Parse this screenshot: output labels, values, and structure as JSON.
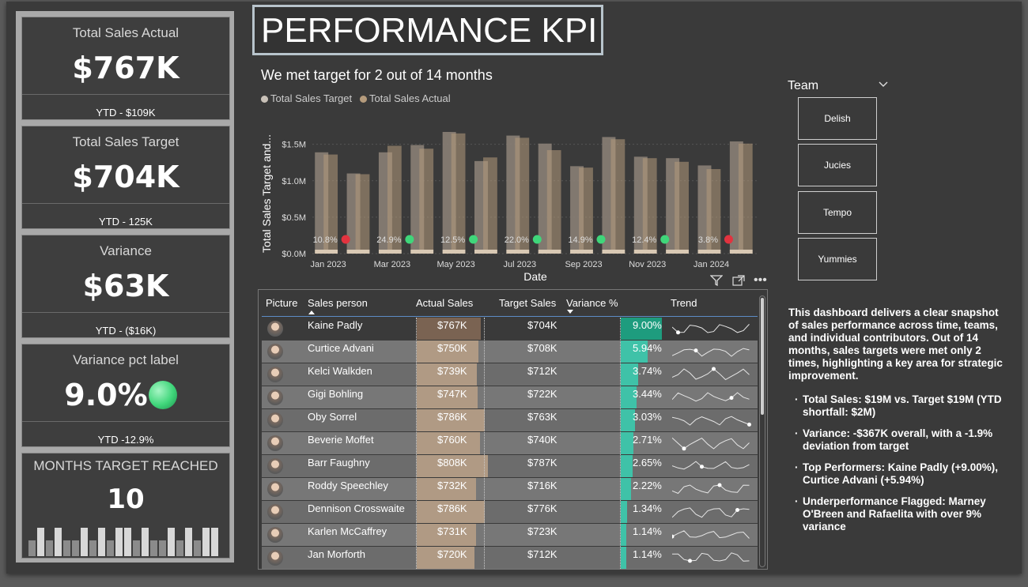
{
  "kpi_cards": [
    {
      "title": "Total Sales Actual",
      "value": "$767K",
      "sub": "YTD - $109K"
    },
    {
      "title": "Total Sales Target",
      "value": "$704K",
      "sub": "YTD - 125K"
    },
    {
      "title": "Variance",
      "value": "$63K",
      "sub": "YTD - ($16K)"
    },
    {
      "title": "Variance pct label",
      "value": "9.0%",
      "sub": "YTD -12.9%"
    }
  ],
  "months_card": {
    "title": "MONTHS TARGET REACHED",
    "value": "10"
  },
  "page_title": "PERFORMANCE KPI",
  "chart_heading": "We met target for 2 out of 14 months",
  "colors": {
    "target": "#8a7f76",
    "actual": "#b59b7c",
    "green": "#3fd67a",
    "red": "#e2333f",
    "teal": "#3fc2a8",
    "panel": "#3a3a3a"
  },
  "chart_data": {
    "type": "bar",
    "legend": [
      "Total Sales Target",
      "Total Sales Actual"
    ],
    "legend_position": "top-left",
    "ylabel": "Total Sales Target and...",
    "xlabel": "Date",
    "x_ticks": [
      "Jan 2023",
      "Mar 2023",
      "May 2023",
      "Jul 2023",
      "Sep 2023",
      "Nov 2023",
      "Jan 2024"
    ],
    "y_ticks": [
      "$0.0M",
      "$0.5M",
      "$1.0M",
      "$1.5M"
    ],
    "ylim": [
      0,
      1.8
    ],
    "grid": true,
    "series": [
      {
        "name": "Total Sales Target",
        "values": [
          1.39,
          1.1,
          1.39,
          1.49,
          1.67,
          1.27,
          1.62,
          1.51,
          1.2,
          1.6,
          1.33,
          1.31,
          1.21,
          1.54
        ]
      },
      {
        "name": "Total Sales Actual",
        "values": [
          1.36,
          1.09,
          1.48,
          1.44,
          1.65,
          1.32,
          1.59,
          1.42,
          1.18,
          1.57,
          1.31,
          1.26,
          1.16,
          1.51
        ]
      }
    ],
    "variance_labels": [
      {
        "month_index": 0,
        "label": "10.8%",
        "status": "red"
      },
      {
        "month_index": 2,
        "label": "24.9%",
        "status": "green"
      },
      {
        "month_index": 4,
        "label": "12.5%",
        "status": "green"
      },
      {
        "month_index": 6,
        "label": "22.0%",
        "status": "green"
      },
      {
        "month_index": 8,
        "label": "14.9%",
        "status": "green"
      },
      {
        "month_index": 10,
        "label": "12.4%",
        "status": "green"
      },
      {
        "month_index": 12,
        "label": "3.8%",
        "status": "red"
      }
    ]
  },
  "slicer": {
    "title": "Team",
    "options": [
      "Delish",
      "Jucies",
      "Tempo",
      "Yummies"
    ]
  },
  "table": {
    "headers": [
      "Picture",
      "Sales person",
      "Actual Sales",
      "Target Sales",
      "Variance %",
      "Trend"
    ],
    "rows": [
      {
        "name": "Kaine Padly",
        "actual": "$767K",
        "target": "$704K",
        "variance": "9.00%",
        "pct": 9.0,
        "bar": 0.81
      },
      {
        "name": "Curtice Advani",
        "actual": "$750K",
        "target": "$708K",
        "variance": "5.94%",
        "pct": 5.94,
        "bar": 0.78
      },
      {
        "name": "Kelci Walkden",
        "actual": "$739K",
        "target": "$712K",
        "variance": "3.74%",
        "pct": 3.74,
        "bar": 0.76
      },
      {
        "name": "Gigi Bohling",
        "actual": "$747K",
        "target": "$722K",
        "variance": "3.44%",
        "pct": 3.44,
        "bar": 0.77
      },
      {
        "name": "Oby Sorrel",
        "actual": "$786K",
        "target": "$763K",
        "variance": "3.03%",
        "pct": 3.03,
        "bar": 0.86
      },
      {
        "name": "Beverie Moffet",
        "actual": "$760K",
        "target": "$740K",
        "variance": "2.71%",
        "pct": 2.71,
        "bar": 0.8
      },
      {
        "name": "Barr Faughny",
        "actual": "$808K",
        "target": "$787K",
        "variance": "2.65%",
        "pct": 2.65,
        "bar": 0.9
      },
      {
        "name": "Roddy Speechley",
        "actual": "$732K",
        "target": "$716K",
        "variance": "2.22%",
        "pct": 2.22,
        "bar": 0.75
      },
      {
        "name": "Dennison Crosswaite",
        "actual": "$786K",
        "target": "$776K",
        "variance": "1.34%",
        "pct": 1.34,
        "bar": 0.86
      },
      {
        "name": "Karlen McCaffrey",
        "actual": "$731K",
        "target": "$723K",
        "variance": "1.14%",
        "pct": 1.14,
        "bar": 0.75
      },
      {
        "name": "Jan Morforth",
        "actual": "$720K",
        "target": "$712K",
        "variance": "1.14%",
        "pct": 1.14,
        "bar": 0.73
      }
    ]
  },
  "description": {
    "intro": "This dashboard delivers a clear snapshot of sales performance across time, teams, and individual contributors. Out of 14 months, sales targets were met only 2 times, highlighting a key area for strategic improvement.",
    "bullets": [
      "Total Sales: $19M vs. Target $19M (YTD shortfall: $2M)",
      "Variance: -$367K overall, with a -1.9% deviation from target",
      "Top Performers: Kaine Padly (+9.00%), Curtice Advani (+5.94%)",
      "Underperformance Flagged: Marney O'Breen and Rafaelita with over 9% variance"
    ]
  }
}
